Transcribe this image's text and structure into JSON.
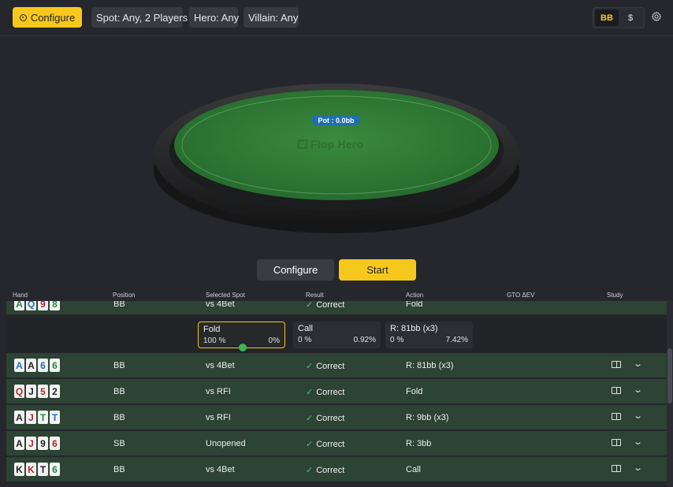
{
  "topbar": {
    "configure_label": "Configure",
    "chips": [
      "Spot: Any, 2 Players",
      "Hero: Any",
      "Villain: Any"
    ],
    "units": [
      "BB",
      "$"
    ],
    "active_unit": "BB"
  },
  "table": {
    "pot_label": "Pot : 0.0bb",
    "brand": "Flop Hero",
    "felt_color": "#2f7c37"
  },
  "actions": {
    "configure_label": "Configure",
    "start_label": "Start"
  },
  "columns": [
    "Hand",
    "Position",
    "Selected Spot",
    "Result",
    "Action",
    "GTO ΔEV",
    "Study"
  ],
  "partial_row": {
    "cards": [
      {
        "r": "A",
        "s": "c"
      },
      {
        "r": "Q",
        "s": "d"
      },
      {
        "r": "9",
        "s": "h"
      },
      {
        "r": "8",
        "s": "c"
      }
    ],
    "position": "BB",
    "spot": "vs 4Bet",
    "result": "Correct",
    "action": "Fold"
  },
  "expanded_options": [
    {
      "name": "Fold",
      "left": "100 %",
      "right": "0%",
      "selected": true
    },
    {
      "name": "Call",
      "left": "0 %",
      "right": "0.92%",
      "selected": false
    },
    {
      "name": "R: 81bb (x3)",
      "left": "0 %",
      "right": "7.42%",
      "selected": false
    }
  ],
  "rows": [
    {
      "cards": [
        {
          "r": "A",
          "s": "d"
        },
        {
          "r": "A",
          "s": "s"
        },
        {
          "r": "6",
          "s": "d"
        },
        {
          "r": "6",
          "s": "c"
        }
      ],
      "position": "BB",
      "spot": "vs 4Bet",
      "result": "Correct",
      "action": "R: 81bb (x3)"
    },
    {
      "cards": [
        {
          "r": "Q",
          "s": "h"
        },
        {
          "r": "J",
          "s": "s"
        },
        {
          "r": "5",
          "s": "h"
        },
        {
          "r": "2",
          "s": "s"
        }
      ],
      "position": "BB",
      "spot": "vs RFI",
      "result": "Correct",
      "action": "Fold"
    },
    {
      "cards": [
        {
          "r": "A",
          "s": "s"
        },
        {
          "r": "J",
          "s": "h"
        },
        {
          "r": "T",
          "s": "c"
        },
        {
          "r": "T",
          "s": "d"
        }
      ],
      "position": "BB",
      "spot": "vs RFI",
      "result": "Correct",
      "action": "R: 9bb (x3)"
    },
    {
      "cards": [
        {
          "r": "A",
          "s": "s"
        },
        {
          "r": "J",
          "s": "h"
        },
        {
          "r": "9",
          "s": "s"
        },
        {
          "r": "6",
          "s": "h"
        }
      ],
      "position": "SB",
      "spot": "Unopened",
      "result": "Correct",
      "action": "R: 3bb"
    },
    {
      "cards": [
        {
          "r": "K",
          "s": "s"
        },
        {
          "r": "K",
          "s": "h"
        },
        {
          "r": "T",
          "s": "s"
        },
        {
          "r": "6",
          "s": "c"
        }
      ],
      "position": "BB",
      "spot": "vs 4Bet",
      "result": "Correct",
      "action": "Call"
    }
  ]
}
